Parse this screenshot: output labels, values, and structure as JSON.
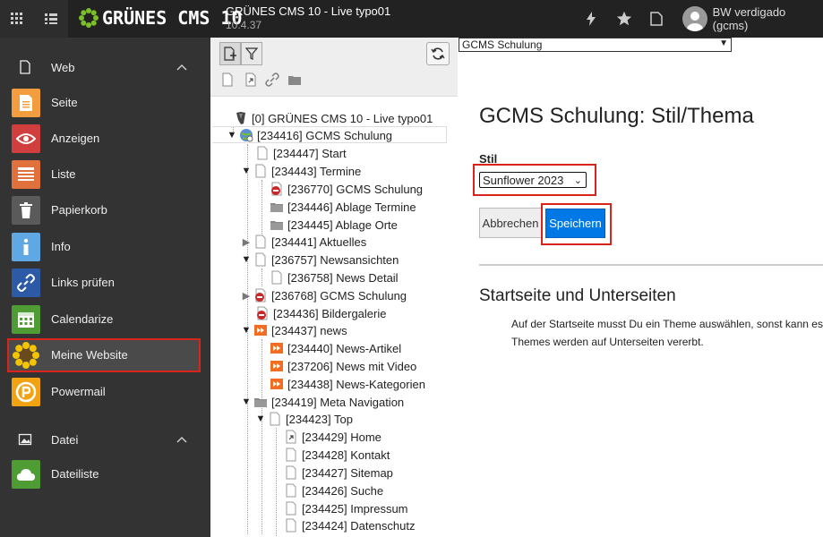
{
  "topbar": {
    "logo_text": "GRÜNES CMS 10",
    "site_title": "GRÜNES CMS 10 - Live typo01",
    "site_version": "10.4.37",
    "user_name": "BW verdigado (gcms)",
    "icons": [
      "module-menu-icon",
      "list-icon",
      "flash-icon",
      "star-icon",
      "document-icon",
      "user-avatar-icon"
    ]
  },
  "sidebar": {
    "groups": [
      {
        "label": "Web",
        "icon": "page-icon"
      },
      {
        "label": "Datei",
        "icon": "image-icon"
      }
    ],
    "items": [
      {
        "label": "Seite",
        "color": "#f49d3e",
        "icon": "page-icon"
      },
      {
        "label": "Anzeigen",
        "color": "#d13e3e",
        "icon": "eye-icon"
      },
      {
        "label": "Liste",
        "color": "#e0703c",
        "icon": "list-icon"
      },
      {
        "label": "Papierkorb",
        "color": "#5a5a5a",
        "icon": "trash-icon"
      },
      {
        "label": "Info",
        "color": "#5fa8e4",
        "icon": "info-icon"
      },
      {
        "label": "Links prüfen",
        "color": "#2d5aa6",
        "icon": "link-icon"
      },
      {
        "label": "Calendarize",
        "color": "#4f9b34",
        "icon": "calendar-icon"
      },
      {
        "label": "Meine Website",
        "color": "#4a4a4a",
        "icon": "sunflower-icon"
      },
      {
        "label": "Powermail",
        "color": "#f2a312",
        "icon": "powermail-icon"
      },
      {
        "label": "Dateiliste",
        "color": "#4f9b34",
        "icon": "cloud-icon"
      }
    ]
  },
  "tree": {
    "nodes": [
      {
        "label": "[0] GRÜNES CMS 10 - Live typo01",
        "icon": "typo3-root-icon"
      },
      {
        "label": "[234416] GCMS Schulung",
        "icon": "globe-page-icon"
      },
      {
        "label": "[234447] Start",
        "icon": "page-icon"
      },
      {
        "label": "[234443] Termine",
        "icon": "page-icon"
      },
      {
        "label": "[236770] GCMS Schulung",
        "icon": "restricted-page-icon"
      },
      {
        "label": "[234446] Ablage Termine",
        "icon": "folder-icon"
      },
      {
        "label": "[234445] Ablage Orte",
        "icon": "folder-icon"
      },
      {
        "label": "[234441] Aktuelles",
        "icon": "page-icon"
      },
      {
        "label": "[236757] Newsansichten",
        "icon": "page-icon"
      },
      {
        "label": "[236758] News Detail",
        "icon": "page-icon"
      },
      {
        "label": "[236768] GCMS Schulung",
        "icon": "restricted-page-icon"
      },
      {
        "label": "[234436] Bildergalerie",
        "icon": "restricted-page-icon"
      },
      {
        "label": "[234437] news",
        "icon": "news-folder-icon"
      },
      {
        "label": "[234440] News-Artikel",
        "icon": "news-folder-icon"
      },
      {
        "label": "[237206] News mit Video",
        "icon": "news-folder-icon"
      },
      {
        "label": "[234438] News-Kategorien",
        "icon": "news-folder-icon"
      },
      {
        "label": "[234419] Meta Navigation",
        "icon": "folder-icon"
      },
      {
        "label": "[234423] Top",
        "icon": "page-icon"
      },
      {
        "label": "[234429] Home",
        "icon": "shortcut-page-icon"
      },
      {
        "label": "[234428] Kontakt",
        "icon": "page-icon"
      },
      {
        "label": "[234427] Sitemap",
        "icon": "page-icon"
      },
      {
        "label": "[234426] Suche",
        "icon": "page-icon"
      },
      {
        "label": "[234425] Impressum",
        "icon": "page-icon"
      },
      {
        "label": "[234424] Datenschutz",
        "icon": "page-icon"
      }
    ]
  },
  "content": {
    "page_select_value": "GCMS Schulung",
    "title": "GCMS Schulung: Stil/Thema",
    "stil_label": "Stil",
    "stil_value": "Sunflower 2023",
    "cancel_label": "Abbrechen",
    "save_label": "Speichern",
    "subtitle": "Startseite und Unterseiten",
    "bullets": [
      "Auf der Startseite musst Du ein Theme auswählen, sonst kann es z",
      "Themes werden auf Unterseiten vererbt."
    ]
  },
  "colors": {
    "highlight": "#d9241c",
    "save_button": "#0078e6",
    "sidebar_bg": "#333333",
    "topbar_bg": "#222222"
  }
}
